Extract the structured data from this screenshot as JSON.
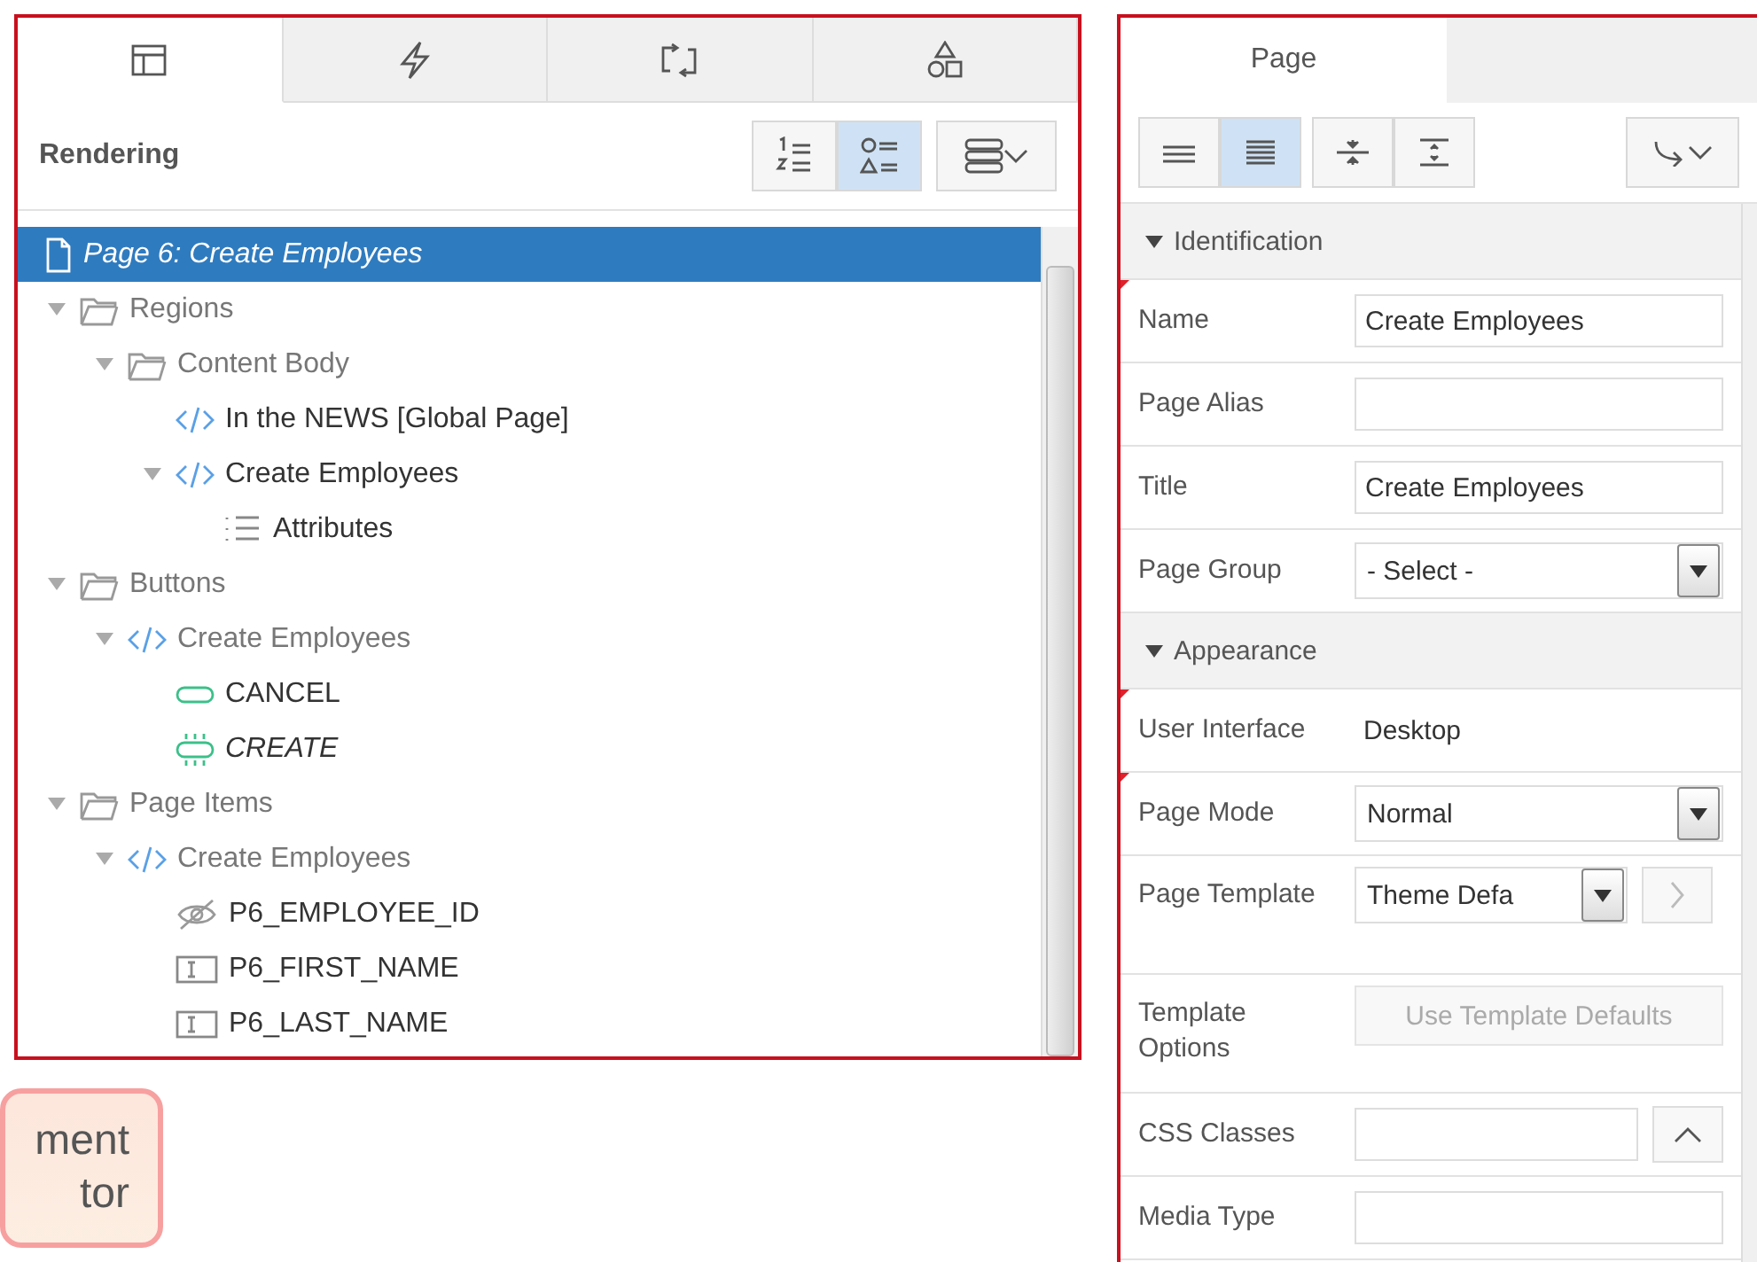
{
  "left_panel": {
    "tabs": [
      {
        "selected": true
      },
      {
        "selected": false
      },
      {
        "selected": false
      },
      {
        "selected": false
      }
    ],
    "title": "Rendering",
    "view_buttons": [
      {
        "selected": false
      },
      {
        "selected": true
      }
    ],
    "tree": [
      {
        "label": "Page 6: Create Employees",
        "kind": "page",
        "selected": true,
        "dimmed": false
      },
      {
        "label": "Regions",
        "kind": "folder",
        "selected": false,
        "dimmed": true,
        "expanded": true,
        "children": [
          {
            "label": "Content Body",
            "kind": "folder",
            "selected": false,
            "dimmed": true,
            "expanded": true,
            "children": [
              {
                "label": "In the NEWS [Global Page]",
                "kind": "region",
                "selected": false,
                "dimmed": false
              },
              {
                "label": "Create Employees",
                "kind": "region",
                "selected": false,
                "dimmed": false,
                "expanded": true,
                "children": [
                  {
                    "label": "Attributes",
                    "kind": "attributes",
                    "selected": false,
                    "dimmed": false
                  }
                ]
              }
            ]
          }
        ]
      },
      {
        "label": "Buttons",
        "kind": "folder",
        "selected": false,
        "dimmed": true,
        "expanded": true,
        "children": [
          {
            "label": "Create Employees",
            "kind": "region",
            "selected": false,
            "dimmed": true,
            "expanded": true,
            "children": [
              {
                "label": "CANCEL",
                "kind": "button",
                "selected": false,
                "dimmed": false
              },
              {
                "label": "CREATE",
                "kind": "button-hot",
                "selected": false,
                "dimmed": false
              }
            ]
          }
        ]
      },
      {
        "label": "Page Items",
        "kind": "folder",
        "selected": false,
        "dimmed": true,
        "expanded": true,
        "children": [
          {
            "label": "Create Employees",
            "kind": "region",
            "selected": false,
            "dimmed": true,
            "expanded": true,
            "children": [
              {
                "label": "P6_EMPLOYEE_ID",
                "kind": "hidden-item",
                "selected": false,
                "dimmed": false
              },
              {
                "label": "P6_FIRST_NAME",
                "kind": "text-item",
                "selected": false,
                "dimmed": false
              },
              {
                "label": "P6_LAST_NAME",
                "kind": "text-item",
                "selected": false,
                "dimmed": false
              }
            ]
          }
        ]
      }
    ]
  },
  "callout": {
    "lines": [
      "ment",
      "tor"
    ]
  },
  "right_panel": {
    "tab": {
      "label": "Page",
      "selected": true
    },
    "toolbar": [
      {
        "selected": false
      },
      {
        "selected": true
      },
      {
        "selected": false
      },
      {
        "selected": false
      }
    ],
    "sections": [
      {
        "title": "Identification",
        "expanded": true,
        "rows": [
          {
            "label": "Name",
            "kind": "text",
            "value": "Create Employees",
            "required": true
          },
          {
            "label": "Page Alias",
            "kind": "text",
            "value": "",
            "required": false
          },
          {
            "label": "Title",
            "kind": "text",
            "value": "Create Employees",
            "required": false
          },
          {
            "label": "Page Group",
            "kind": "select",
            "value": "- Select -",
            "required": false
          }
        ]
      },
      {
        "title": "Appearance",
        "expanded": true,
        "rows": [
          {
            "label": "User Interface",
            "kind": "static",
            "value": "Desktop",
            "required": true
          },
          {
            "label": "Page Mode",
            "kind": "select",
            "value": "Normal",
            "required": true
          },
          {
            "label": "Page Template",
            "kind": "select-link",
            "value": "Theme Defa",
            "required": false
          },
          {
            "label": "Template Options",
            "kind": "button",
            "value": "Use Template Defaults",
            "required": false
          },
          {
            "label": "CSS Classes",
            "kind": "picker",
            "value": "",
            "required": false
          },
          {
            "label": "Media Type",
            "kind": "text",
            "value": "",
            "required": false
          }
        ]
      }
    ]
  }
}
